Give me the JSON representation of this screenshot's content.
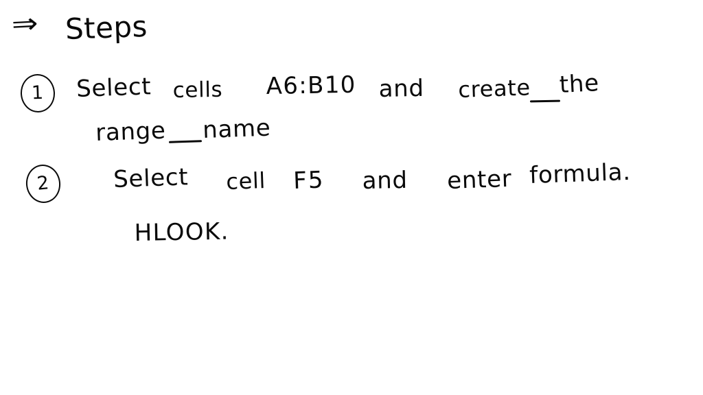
{
  "note": {
    "background_color": "#ffffff",
    "ink_color": "#0a0a0a",
    "medium": "handwritten-note",
    "header": {
      "arrow": "⇒",
      "title": "Steps"
    },
    "steps": [
      {
        "marker": "1",
        "lines": [
          {
            "words": [
              "Select",
              "cells",
              "A6:B10",
              "and",
              "create",
              "the"
            ]
          },
          {
            "words": [
              "range",
              "name"
            ]
          }
        ]
      },
      {
        "marker": "2",
        "lines": [
          {
            "words": [
              "Select",
              "cell",
              "F5",
              "and",
              "enter",
              "formula."
            ]
          },
          {
            "words": [
              "HLOOK."
            ]
          }
        ]
      }
    ],
    "full_text": "⇒ Steps  (1) Select cells A6:B10 and create the range name  (2) Select cell F5 and enter formula. HLOOK."
  }
}
